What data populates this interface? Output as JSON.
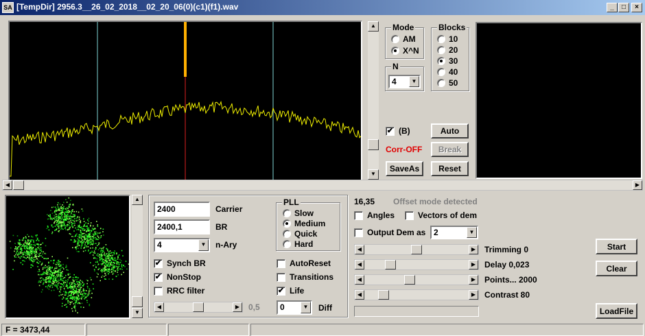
{
  "window": {
    "title": "[TempDir] 2956.3__26_02_2018__02_20_06(0)(c1)(f1).wav",
    "icon_text": "SA",
    "min": "_",
    "max": "□",
    "close": "×"
  },
  "mode": {
    "caption": "Mode",
    "options": [
      "AM",
      "X^N"
    ],
    "selected": 1
  },
  "blocks": {
    "caption": "Blocks",
    "options": [
      "10",
      "20",
      "30",
      "40",
      "50"
    ],
    "selected": 2
  },
  "n_group": {
    "caption": "N",
    "value": "4"
  },
  "b_check": {
    "label": "(B)",
    "checked": true
  },
  "corr_status": "Corr-OFF",
  "buttons": {
    "auto": "Auto",
    "break": "Break",
    "saveas": "SaveAs",
    "reset": "Reset",
    "start": "Start",
    "clear": "Clear",
    "loadfile": "LoadFile"
  },
  "carrier": {
    "value": "2400",
    "label": "Carrier"
  },
  "br": {
    "value": "2400,1",
    "label": "BR"
  },
  "nary": {
    "value": "4",
    "label": "n-Ary"
  },
  "pll": {
    "caption": "PLL",
    "options": [
      "Slow",
      "Medium",
      "Quick",
      "Hard"
    ],
    "selected": 1
  },
  "checks_left": [
    {
      "label": "Synch BR",
      "checked": true
    },
    {
      "label": "NonStop",
      "checked": true
    },
    {
      "label": "RRC filter",
      "checked": false
    }
  ],
  "checks_right": [
    {
      "label": "AutoReset",
      "checked": false
    },
    {
      "label": "Transitions",
      "checked": false
    },
    {
      "label": "Life",
      "checked": true
    }
  ],
  "filter_value": "0,5",
  "diff": {
    "value": "0",
    "label": "Diff"
  },
  "offset": {
    "value": "16,35",
    "status": "Offset mode detected"
  },
  "angles": {
    "label": "Angles",
    "checked": false
  },
  "vectors": {
    "label": "Vectors of dem",
    "checked": false
  },
  "output_dem": {
    "label": "Output Dem as",
    "checked": false,
    "value": "2"
  },
  "sliders": [
    {
      "label": "Trimming 0",
      "level": 0.5
    },
    {
      "label": "Delay  0,023",
      "level": 0.22
    },
    {
      "label": "Points... 2000",
      "level": 0.43
    },
    {
      "label": "Contrast 80",
      "level": 0.15
    }
  ],
  "status_bar": {
    "freq": "F = 3473,44"
  },
  "colors": {
    "spectrum_bg": "#000000",
    "trace": "#f0f000",
    "marker_cyan": "#7fd6d6",
    "marker_red": "#e02020",
    "constellation": "#22ff22"
  }
}
